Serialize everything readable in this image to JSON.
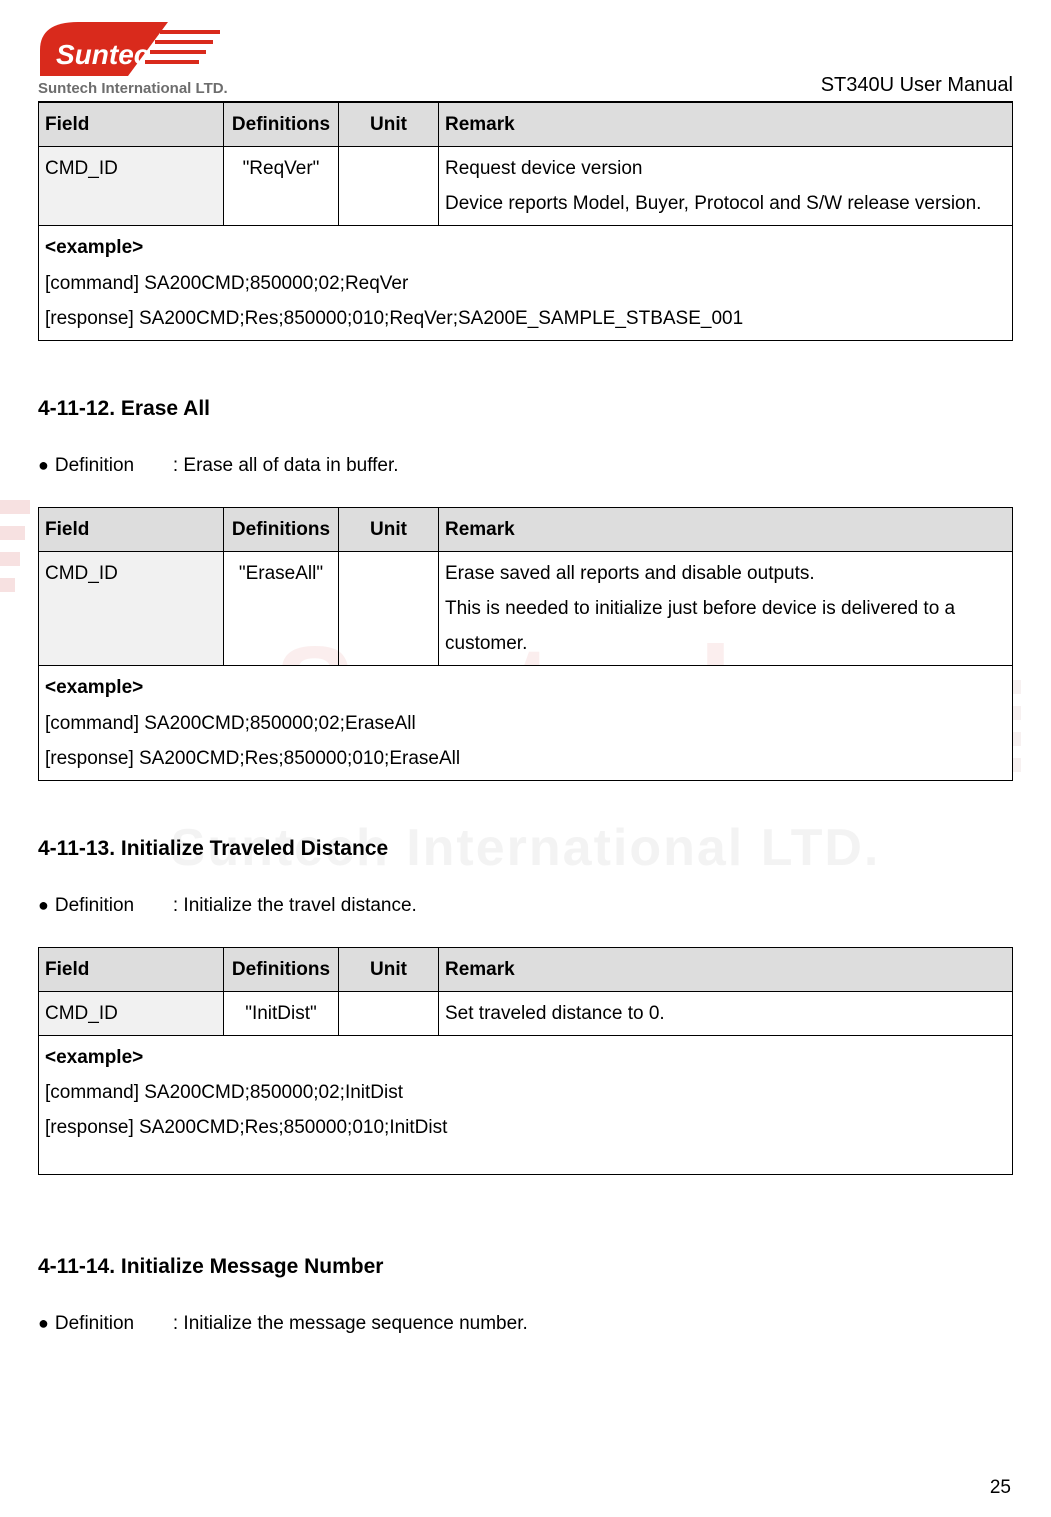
{
  "header": {
    "logo_company": "Suntech International LTD.",
    "doc_title": "ST340U User Manual"
  },
  "table1": {
    "headers": {
      "c1": "Field",
      "c2": "Definitions",
      "c3": "Unit",
      "c4": "Remark"
    },
    "row": {
      "field": "CMD_ID",
      "def": "\"ReqVer\"",
      "unit": "",
      "remark_line1": "Request device version",
      "remark_line2": "Device reports Model, Buyer, Protocol and S/W release version."
    },
    "example_label": "<example>",
    "example_cmd": "[command] SA200CMD;850000;02;ReqVer",
    "example_res": "[response] SA200CMD;Res;850000;010;ReqVer;SA200E_SAMPLE_STBASE_001"
  },
  "section12": {
    "heading": "4-11-12. Erase All",
    "def_label": "Definition",
    "def_text": ": Erase all of data in buffer."
  },
  "table2": {
    "headers": {
      "c1": "Field",
      "c2": "Definitions",
      "c3": "Unit",
      "c4": "Remark"
    },
    "row": {
      "field": "CMD_ID",
      "def": "\"EraseAll\"",
      "unit": "",
      "remark_line1": "Erase saved all reports and disable outputs.",
      "remark_line2": "This is needed to initialize just before device is delivered to a customer."
    },
    "example_label": "<example>",
    "example_cmd": "[command] SA200CMD;850000;02;EraseAll",
    "example_res": "[response] SA200CMD;Res;850000;010;EraseAll"
  },
  "section13": {
    "heading": "4-11-13. Initialize Traveled Distance",
    "def_label": "Definition",
    "def_text": ": Initialize the travel distance."
  },
  "table3": {
    "headers": {
      "c1": "Field",
      "c2": "Definitions",
      "c3": "Unit",
      "c4": "Remark"
    },
    "row": {
      "field": "CMD_ID",
      "def": "\"InitDist\"",
      "unit": "",
      "remark": "Set traveled distance to 0."
    },
    "example_label": "<example>",
    "example_cmd": "[command] SA200CMD;850000;02;InitDist",
    "example_res": "[response] SA200CMD;Res;850000;010;InitDist"
  },
  "section14": {
    "heading": "4-11-14. Initialize Message Number",
    "def_label": "Definition",
    "def_text": ": Initialize the message sequence number."
  },
  "page_number": "25",
  "watermark": {
    "big": "Suntech",
    "sub": "Suntech International LTD."
  }
}
